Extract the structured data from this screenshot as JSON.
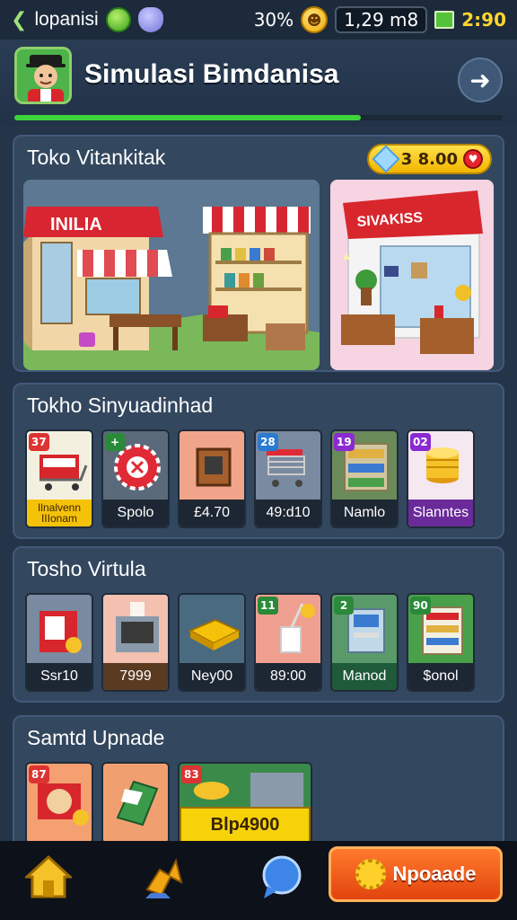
{
  "status": {
    "app": "lopanisi",
    "battery_pct": "30%",
    "network": "1,29 m8",
    "time": "2:90"
  },
  "header": {
    "title": "Simulasi Bimdanisa",
    "progress": 0.71
  },
  "featured": {
    "title": "Toko Vitankitak",
    "price": "3 8.00",
    "shop1_sign": "INILIA",
    "shop2_sign": "SIVAKISS"
  },
  "section1": {
    "title": "Tokho Sinyuadinhad",
    "items": [
      {
        "badge": "37",
        "label": "Ilnalvenn\nIIIonam",
        "icon": "shopping-cart-icon"
      },
      {
        "badge": "+",
        "label": "Spolo",
        "icon": "red-sign-icon"
      },
      {
        "badge": "",
        "label": "£4.70",
        "icon": "cabinet-icon"
      },
      {
        "badge": "28",
        "label": "49:d10",
        "icon": "cart-rack-icon"
      },
      {
        "badge": "19",
        "label": "Namlo",
        "icon": "shelf-icon"
      },
      {
        "badge": "02",
        "label": "Slanntes",
        "icon": "coin-stack-icon"
      }
    ]
  },
  "section2": {
    "title": "Tosho Virtula",
    "items": [
      {
        "badge": "",
        "label": "Ssr10",
        "icon": "vending-icon"
      },
      {
        "badge": "",
        "label": "7999",
        "icon": "oven-icon"
      },
      {
        "badge": "",
        "label": "Ney00",
        "icon": "cheese-tray-icon"
      },
      {
        "badge": "11",
        "label": "89:00",
        "icon": "juice-icon"
      },
      {
        "badge": "2",
        "label": "Manod",
        "icon": "atm-icon"
      },
      {
        "badge": "90",
        "label": "$onol",
        "icon": "display-shelf-icon"
      }
    ]
  },
  "section3": {
    "title": "Samtd Upnade",
    "items": [
      {
        "badge": "87",
        "label": "",
        "icon": "pizza-box-icon"
      },
      {
        "badge": "",
        "label": "",
        "icon": "fridge-icon"
      },
      {
        "badge": "83",
        "label": "Blp4900",
        "icon": "machine-icon"
      }
    ]
  },
  "nav": {
    "upgrade_label": "Npoaade"
  }
}
